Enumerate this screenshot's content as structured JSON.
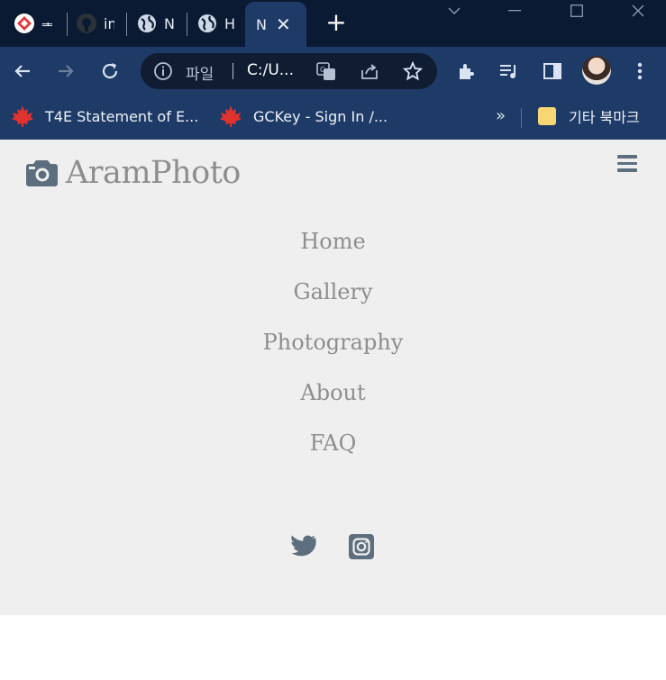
{
  "browser": {
    "tabs": [
      {
        "title": "ᆂ",
        "icon": "app-red-diamond-icon"
      },
      {
        "title": "in",
        "icon": "github-icon"
      },
      {
        "title": "N",
        "icon": "globe-icon"
      },
      {
        "title": "H",
        "icon": "globe-icon"
      },
      {
        "title": "N",
        "icon": "none",
        "active": true
      }
    ],
    "new_tab_label": "+",
    "address": {
      "scheme_label": "파일",
      "url": "C:/U..."
    },
    "bookmarks": [
      {
        "label": "T4E Statement of E...",
        "icon": "maple-leaf-icon"
      },
      {
        "label": "GCKey - Sign In /...",
        "icon": "maple-leaf-icon"
      }
    ],
    "bookmarks_more": "»",
    "other_bookmarks": "기타 북마크"
  },
  "site": {
    "brand": "AramPhoto",
    "nav": [
      "Home",
      "Gallery",
      "Photography",
      "About",
      "FAQ"
    ],
    "social": [
      "twitter-icon",
      "instagram-icon"
    ]
  },
  "colors": {
    "page_bg": "#efefef",
    "nav_text": "#8e8e8e",
    "icon": "#5d6e7e",
    "chrome_dark": "#0b1a33",
    "chrome_bar": "#1e3a66"
  }
}
